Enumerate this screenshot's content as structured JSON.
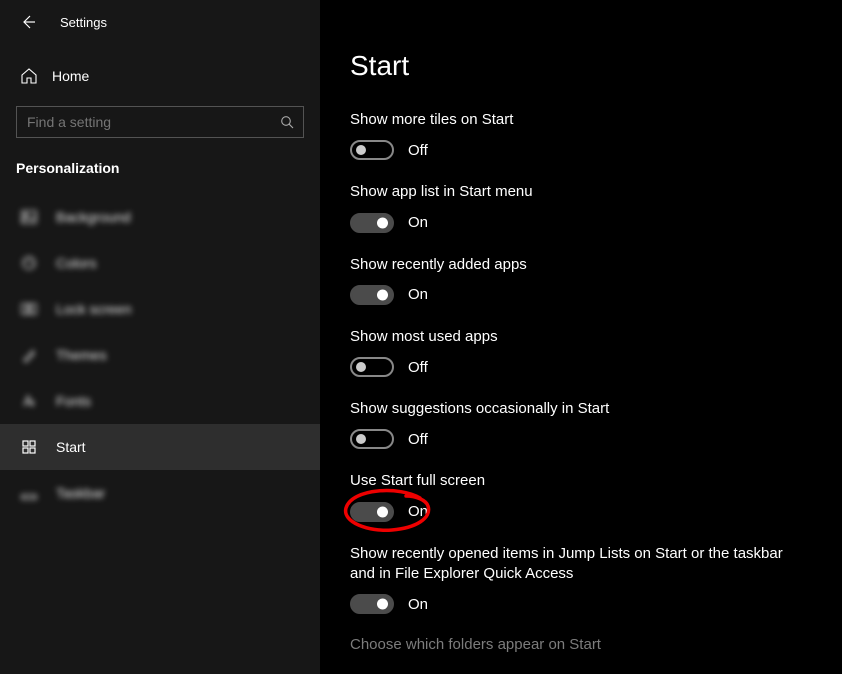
{
  "header": {
    "title": "Settings"
  },
  "home": {
    "label": "Home"
  },
  "search": {
    "placeholder": "Find a setting"
  },
  "category": "Personalization",
  "nav": [
    {
      "key": "background",
      "label": "Background",
      "selected": false,
      "blurred": true
    },
    {
      "key": "colors",
      "label": "Colors",
      "selected": false,
      "blurred": true
    },
    {
      "key": "lock-screen",
      "label": "Lock screen",
      "selected": false,
      "blurred": true
    },
    {
      "key": "themes",
      "label": "Themes",
      "selected": false,
      "blurred": true
    },
    {
      "key": "fonts",
      "label": "Fonts",
      "selected": false,
      "blurred": true
    },
    {
      "key": "start",
      "label": "Start",
      "selected": true,
      "blurred": false
    },
    {
      "key": "taskbar",
      "label": "Taskbar",
      "selected": false,
      "blurred": true
    }
  ],
  "page": {
    "title": "Start"
  },
  "settings": [
    {
      "key": "more-tiles",
      "label": "Show more tiles on Start",
      "on": false,
      "state": "Off",
      "annotated": false
    },
    {
      "key": "app-list",
      "label": "Show app list in Start menu",
      "on": true,
      "state": "On",
      "annotated": false
    },
    {
      "key": "recently-added",
      "label": "Show recently added apps",
      "on": true,
      "state": "On",
      "annotated": false
    },
    {
      "key": "most-used",
      "label": "Show most used apps",
      "on": false,
      "state": "Off",
      "annotated": false
    },
    {
      "key": "suggestions",
      "label": "Show suggestions occasionally in Start",
      "on": false,
      "state": "Off",
      "annotated": false
    },
    {
      "key": "full-screen",
      "label": "Use Start full screen",
      "on": true,
      "state": "On",
      "annotated": true
    },
    {
      "key": "jump-lists",
      "label": "Show recently opened items in Jump Lists on Start or the taskbar and in File Explorer Quick Access",
      "on": true,
      "state": "On",
      "annotated": false
    }
  ],
  "link": "Choose which folders appear on Start",
  "icons": {
    "background": "image",
    "colors": "palette",
    "lock-screen": "lock",
    "themes": "brush",
    "fonts": "fonts",
    "start": "start-grid",
    "taskbar": "taskbar"
  }
}
